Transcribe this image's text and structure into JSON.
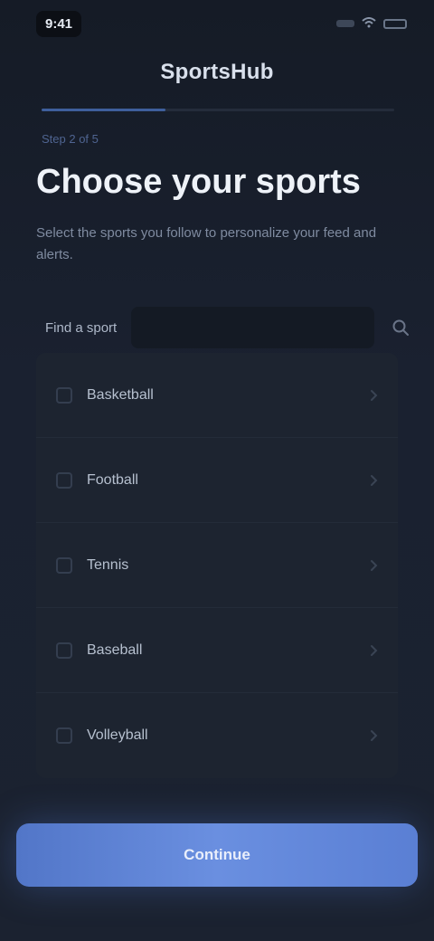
{
  "status_bar": {
    "time": "9:41",
    "icons": [
      "signal-icon",
      "wifi-icon",
      "battery-icon"
    ]
  },
  "header": {
    "brand": "SportsHub"
  },
  "progress": {
    "fraction": 0.35,
    "step_label": "Step 2 of 5"
  },
  "main": {
    "title": "Choose your sports",
    "subtitle": "Select the sports you follow to personalize your feed and alerts."
  },
  "search": {
    "label": "Find a sport",
    "placeholder": "",
    "icon": "search-icon"
  },
  "sports": [
    {
      "label": "Basketball"
    },
    {
      "label": "Football"
    },
    {
      "label": "Tennis"
    },
    {
      "label": "Baseball"
    },
    {
      "label": "Volleyball"
    }
  ],
  "footer": {
    "continue_label": "Continue"
  },
  "colors": {
    "background": "#1a2130",
    "accent": "#5a7fd4",
    "card": "#1d2430"
  }
}
